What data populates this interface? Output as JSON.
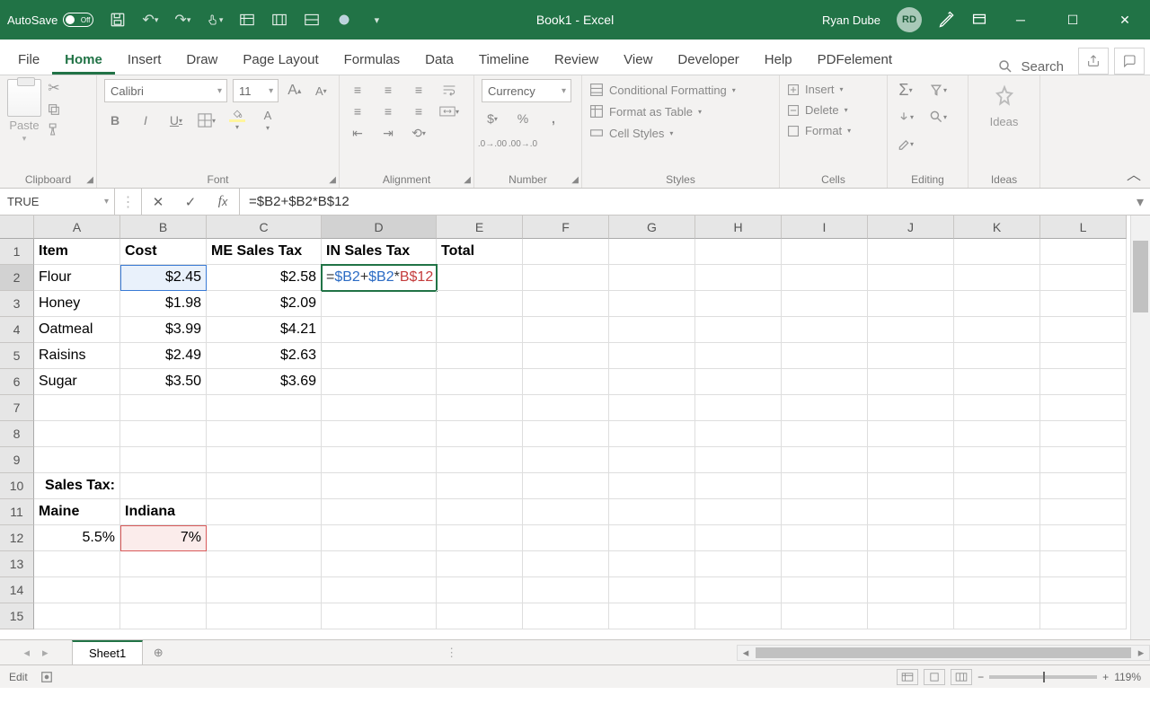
{
  "title_bar": {
    "autosave_label": "AutoSave",
    "autosave_state": "Off",
    "doc_title": "Book1 - Excel",
    "user_name": "Ryan Dube",
    "user_initials": "RD"
  },
  "tabs": {
    "items": [
      "File",
      "Home",
      "Insert",
      "Draw",
      "Page Layout",
      "Formulas",
      "Data",
      "Timeline",
      "Review",
      "View",
      "Developer",
      "Help",
      "PDFelement"
    ],
    "active": "Home",
    "search": "Search"
  },
  "ribbon": {
    "clipboard": {
      "label": "Clipboard",
      "paste": "Paste"
    },
    "font": {
      "label": "Font",
      "name": "Calibri",
      "size": "11"
    },
    "alignment": {
      "label": "Alignment"
    },
    "number": {
      "label": "Number",
      "format": "Currency"
    },
    "styles": {
      "label": "Styles",
      "cond": "Conditional Formatting",
      "table": "Format as Table",
      "cell": "Cell Styles"
    },
    "cells": {
      "label": "Cells",
      "insert": "Insert",
      "delete": "Delete",
      "format": "Format"
    },
    "editing": {
      "label": "Editing"
    },
    "ideas": {
      "label": "Ideas",
      "btn": "Ideas"
    }
  },
  "formula_bar": {
    "name_box": "TRUE",
    "formula": "=$B2+$B2*B$12"
  },
  "columns": [
    "A",
    "B",
    "C",
    "D",
    "E",
    "F",
    "G",
    "H",
    "I",
    "J",
    "K",
    "L"
  ],
  "rows_shown": 15,
  "sheet": {
    "headers": {
      "A1": "Item",
      "B1": "Cost",
      "C1": "ME Sales Tax",
      "D1": "IN Sales Tax",
      "E1": "Total"
    },
    "data": [
      {
        "item": "Flour",
        "cost": "$2.45",
        "me": "$2.58"
      },
      {
        "item": "Honey",
        "cost": "$1.98",
        "me": "$2.09"
      },
      {
        "item": "Oatmeal",
        "cost": "$3.99",
        "me": "$4.21"
      },
      {
        "item": "Raisins",
        "cost": "$2.49",
        "me": "$2.63"
      },
      {
        "item": "Sugar",
        "cost": "$3.50",
        "me": "$3.69"
      }
    ],
    "edit_cell": {
      "parts": [
        "=",
        "$B2",
        "+",
        "$B2",
        "*",
        "B$12"
      ]
    },
    "tax_block": {
      "title": "Sales Tax:",
      "maine_label": "Maine",
      "indiana_label": "Indiana",
      "maine_rate": "5.5%",
      "indiana_rate": "7%"
    }
  },
  "sheet_tab": {
    "name": "Sheet1"
  },
  "status": {
    "mode": "Edit",
    "zoom": "119%"
  }
}
